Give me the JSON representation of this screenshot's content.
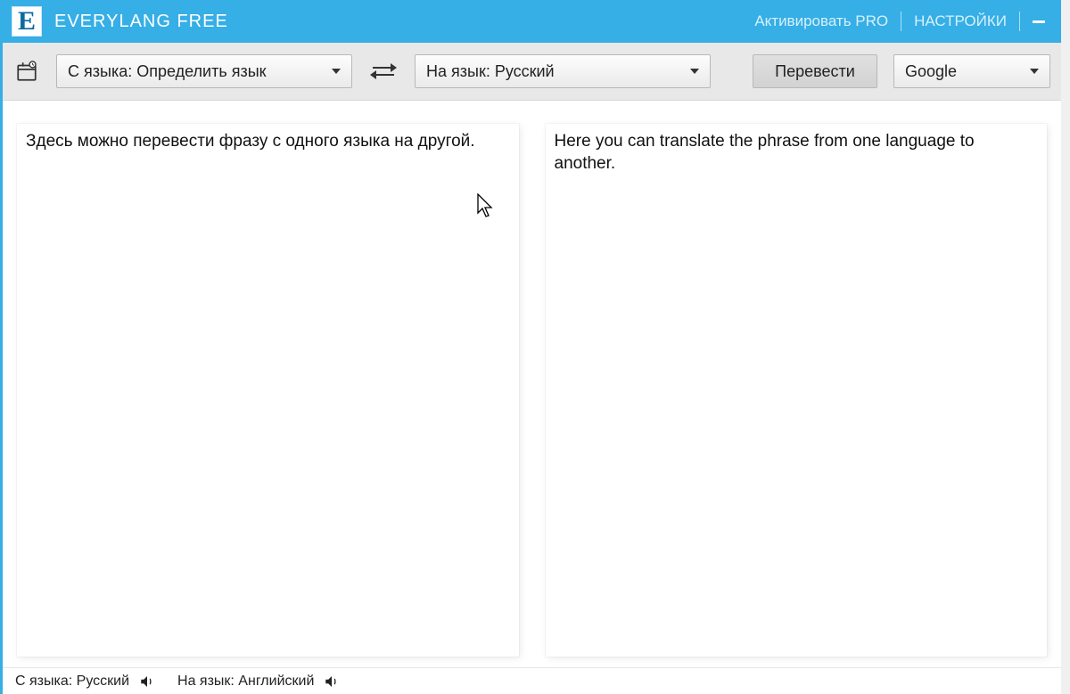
{
  "titlebar": {
    "logo_letter": "E",
    "app_title": "EVERYLANG FREE",
    "activate_pro": "Активировать PRO",
    "settings": "НАСТРОЙКИ"
  },
  "toolbar": {
    "from_label": "С языка: Определить язык",
    "to_label": "На язык: Русский",
    "translate_label": "Перевести",
    "engine_label": "Google"
  },
  "panes": {
    "source_text": "Здесь можно перевести фразу с одного языка на другой.",
    "target_text": "Here you can translate the phrase from one language to another."
  },
  "status": {
    "from": "С языка: Русский",
    "to": "На язык: Английский"
  }
}
